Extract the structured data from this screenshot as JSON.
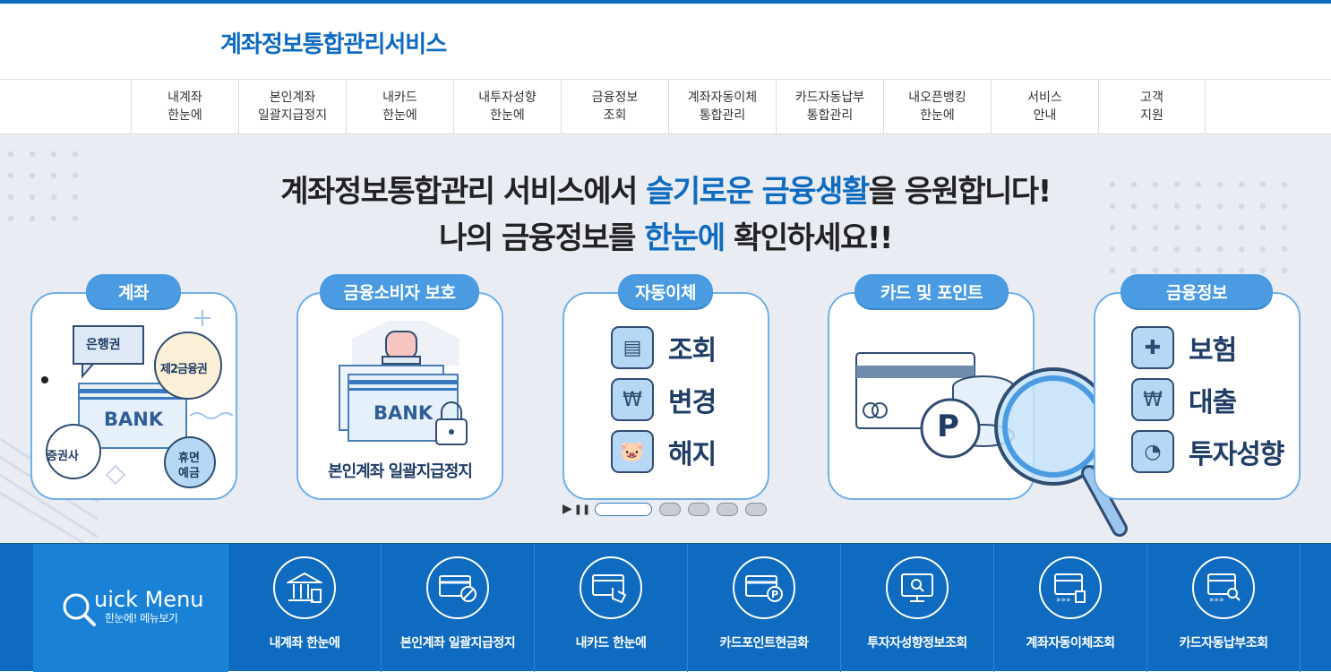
{
  "site": {
    "title": "계좌정보통합관리서비스"
  },
  "nav": [
    {
      "l1": "내계좌",
      "l2": "한눈에"
    },
    {
      "l1": "본인계좌",
      "l2": "일괄지급정지"
    },
    {
      "l1": "내카드",
      "l2": "한눈에"
    },
    {
      "l1": "내투자성향",
      "l2": "한눈에"
    },
    {
      "l1": "금융정보",
      "l2": "조회"
    },
    {
      "l1": "계좌자동이체",
      "l2": "통합관리"
    },
    {
      "l1": "카드자동납부",
      "l2": "통합관리"
    },
    {
      "l1": "내오픈뱅킹",
      "l2": "한눈에"
    },
    {
      "l1": "서비스",
      "l2": "안내"
    },
    {
      "l1": "고객",
      "l2": "지원"
    }
  ],
  "hero": {
    "line1_a": "계좌정보통합관리 서비스에서 ",
    "line1_hl": "슬기로운 금융생활",
    "line1_b": "을 응원합니다!",
    "line2_a": "나의 금융정보를 ",
    "line2_hl": "한눈에",
    "line2_b": " 확인하세요!!",
    "cards": {
      "account": {
        "title": "계좌",
        "bubble1": "은행권",
        "bubble2": "제2금융권",
        "bank": "BANK",
        "bubble3": "증권사",
        "bubble4a": "휴면",
        "bubble4b": "예금"
      },
      "protect": {
        "title": "금융소비자 보호",
        "bank": "BANK",
        "caption": "본인계좌 일괄지급정지"
      },
      "autopay": {
        "title": "자동이체",
        "items": [
          "조회",
          "변경",
          "해지"
        ]
      },
      "card": {
        "title": "카드 및 포인트",
        "point": "P"
      },
      "info": {
        "title": "금융정보",
        "items": [
          "보험",
          "대출",
          "투자성향"
        ]
      }
    }
  },
  "slider": {
    "play": "▶",
    "pause": "❚❚"
  },
  "quick": {
    "title": "uick Menu",
    "title_q": "Q",
    "subtitle": "한눈에! 메뉴보기",
    "items": [
      "내계좌 한눈에",
      "본인계좌 일괄지급정지",
      "내카드 한눈에",
      "카드포인트현금화",
      "투자자성향정보조회",
      "계좌자동이체조회",
      "카드자동납부조회"
    ]
  },
  "colors": {
    "brand": "#0e6bbf",
    "card_border": "#6fb0ea",
    "pill": "#4a9be2",
    "icon_dark": "#1f3d66"
  }
}
